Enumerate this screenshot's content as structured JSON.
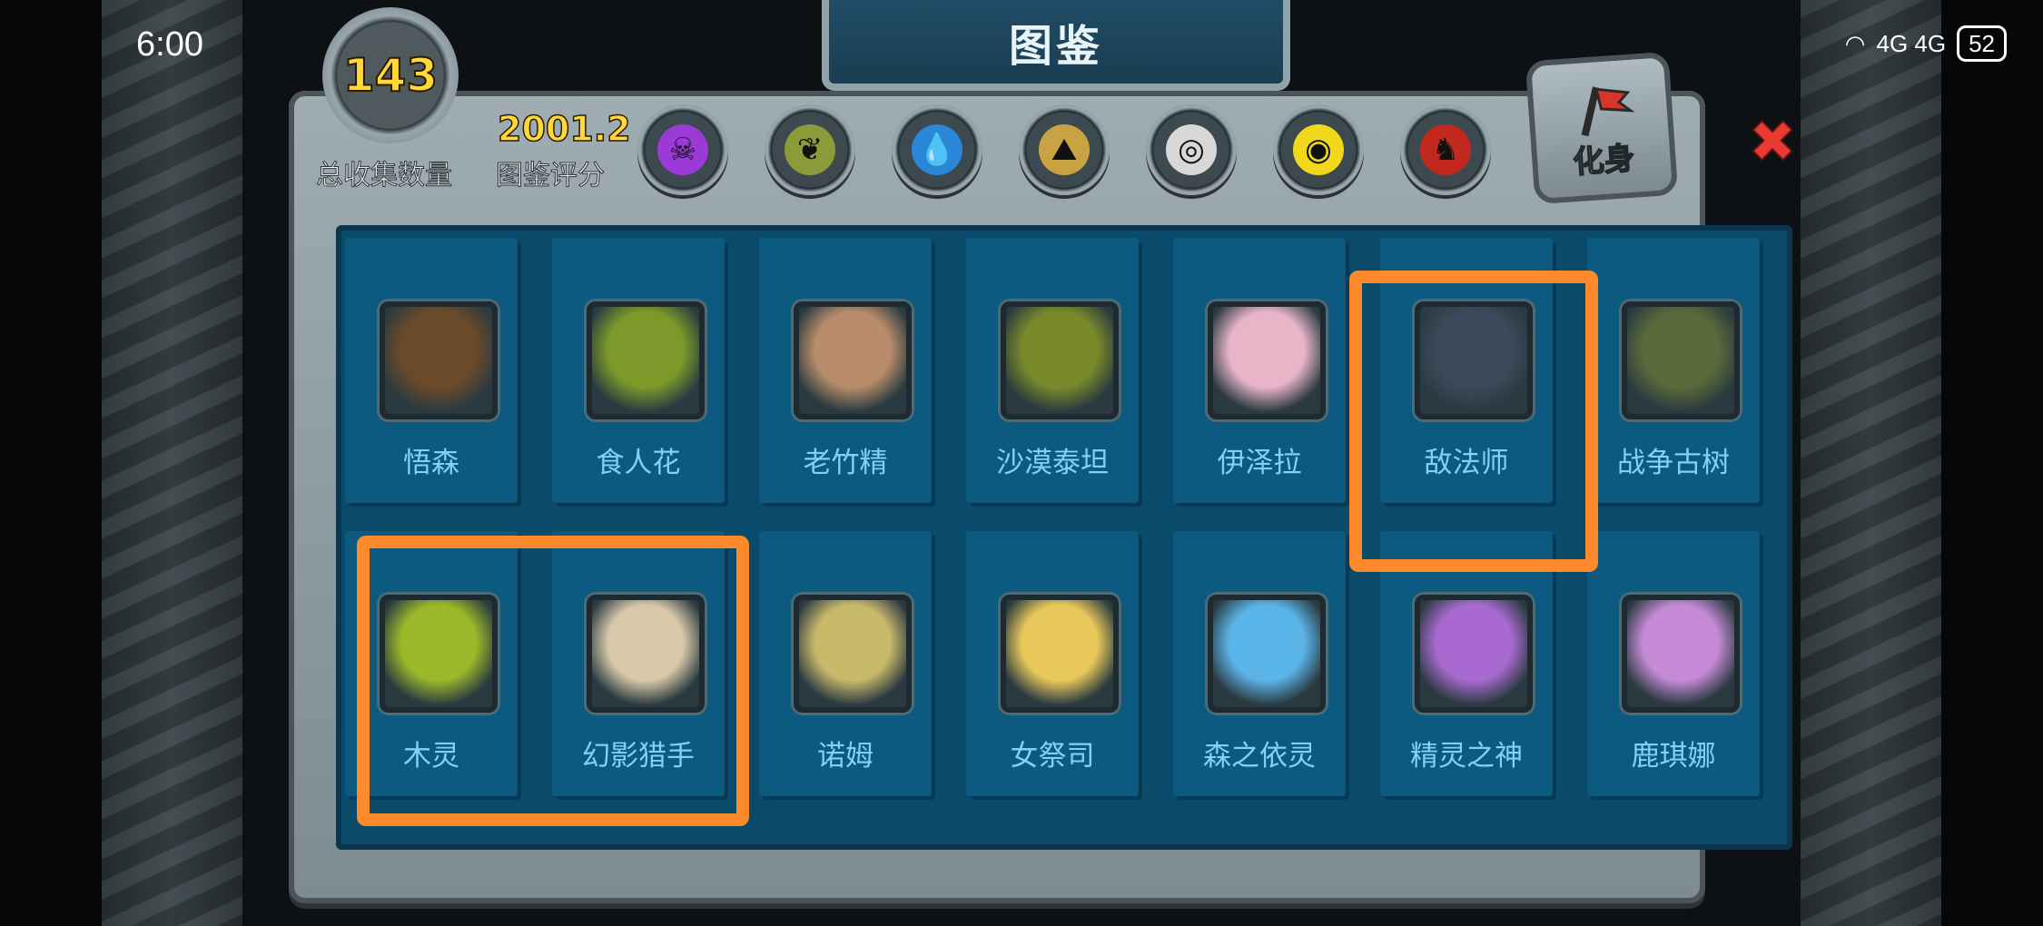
{
  "status_bar": {
    "time": "6:00",
    "signal": "4G 4G",
    "battery": "52"
  },
  "header": {
    "title": "图鉴",
    "total_count": "143",
    "total_count_label": "总收集数量",
    "score": "2001.2",
    "score_label": "图鉴评分",
    "avatar_label": "化身",
    "close_symbol": "✖"
  },
  "element_filters": [
    {
      "icon": "purple-skull-icon",
      "color": "#9b3ad6",
      "glyph": "☠"
    },
    {
      "icon": "nature-leaf-icon",
      "color": "#8c9b3a",
      "glyph": "❦"
    },
    {
      "icon": "water-drop-icon",
      "color": "#2a86d6",
      "glyph": "💧"
    },
    {
      "icon": "earth-rock-icon",
      "color": "#c9a243",
      "glyph": "⛰"
    },
    {
      "icon": "wind-spiral-icon",
      "color": "#d8d8d8",
      "glyph": "◎"
    },
    {
      "icon": "light-eye-icon",
      "color": "#f2d81a",
      "glyph": "◉"
    },
    {
      "icon": "dark-dragon-icon",
      "color": "#c2281e",
      "glyph": "♞"
    }
  ],
  "cards_row1": [
    {
      "name": "悟森",
      "tint": "#6b4a2a"
    },
    {
      "name": "食人花",
      "tint": "#7c9a2a"
    },
    {
      "name": "老竹精",
      "tint": "#b88c6a"
    },
    {
      "name": "沙漠泰坦",
      "tint": "#7a8a2a"
    },
    {
      "name": "伊泽拉",
      "tint": "#e7b4c8"
    },
    {
      "name": "敌法师",
      "tint": "#3a4a5a"
    },
    {
      "name": "战争古树",
      "tint": "#5a6a3a"
    }
  ],
  "cards_row2": [
    {
      "name": "木灵",
      "tint": "#9ab82a"
    },
    {
      "name": "幻影猎手",
      "tint": "#d8c8a8"
    },
    {
      "name": "诺姆",
      "tint": "#c8b86a"
    },
    {
      "name": "女祭司",
      "tint": "#e8c85a"
    },
    {
      "name": "森之依灵",
      "tint": "#5ab4e8"
    },
    {
      "name": "精灵之神",
      "tint": "#a86ad0"
    },
    {
      "name": "鹿琪娜",
      "tint": "#c48ad6"
    }
  ]
}
